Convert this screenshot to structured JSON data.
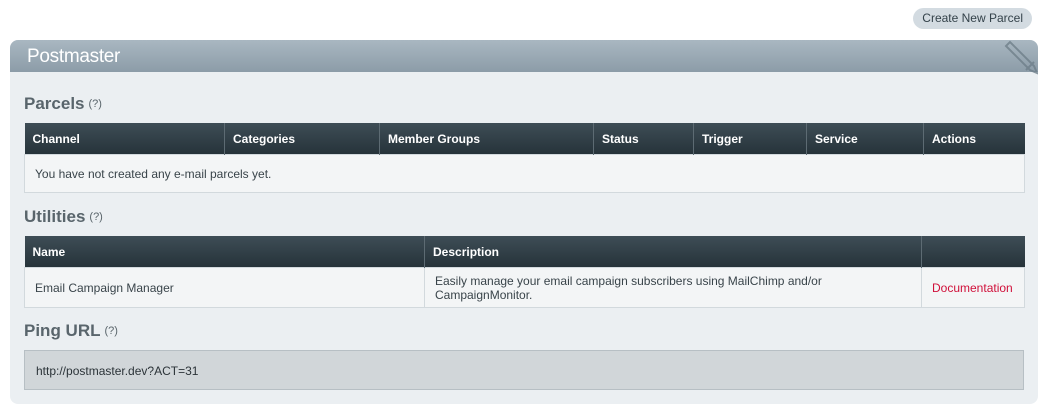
{
  "toolbar": {
    "create_button": "Create New Parcel"
  },
  "panel": {
    "title": "Postmaster"
  },
  "parcels": {
    "title": "Parcels",
    "help": "(?)",
    "columns": [
      "Channel",
      "Categories",
      "Member Groups",
      "Status",
      "Trigger",
      "Service",
      "Actions"
    ],
    "empty_message": "You have not created any e-mail parcels yet."
  },
  "utilities": {
    "title": "Utilities",
    "help": "(?)",
    "columns": [
      "Name",
      "Description",
      ""
    ],
    "rows": [
      {
        "name": "Email Campaign Manager",
        "description": "Easily manage your email campaign subscribers using MailChimp and/or CampaignMonitor.",
        "action": "Documentation"
      }
    ]
  },
  "ping": {
    "title": "Ping URL",
    "help": "(?)",
    "url": "http://postmaster.dev?ACT=31"
  },
  "colors": {
    "header_bg": "#2f3d45",
    "panel_header": "#9aa9b4",
    "link": "#d0103a"
  }
}
